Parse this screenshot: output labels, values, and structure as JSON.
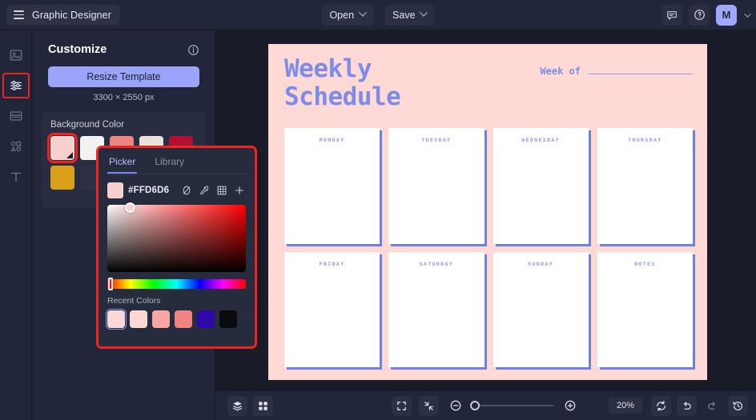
{
  "app": {
    "name": "Graphic Designer",
    "menu_icon": "hamburger-icon"
  },
  "topbar": {
    "open_label": "Open",
    "save_label": "Save",
    "comment_icon": "comment-icon",
    "help_icon": "help-icon",
    "avatar_initial": "M",
    "avatar_color": "#a1a8fb"
  },
  "rail": {
    "items": [
      {
        "name": "image-icon",
        "selected": false
      },
      {
        "name": "adjustments-icon",
        "selected": true
      },
      {
        "name": "layout-icon",
        "selected": false
      },
      {
        "name": "shapes-icon",
        "selected": false
      },
      {
        "name": "text-icon",
        "selected": false
      }
    ]
  },
  "panel": {
    "title": "Customize",
    "info_icon": "info-icon",
    "resize_label": "Resize Template",
    "dimensions": "3300 × 2550 px",
    "background": {
      "label": "Background Color",
      "swatches": [
        {
          "color": "#f8cfcf",
          "selected": true
        },
        {
          "color": "#f2f2f0",
          "selected": false
        },
        {
          "color": "#b11030",
          "selected": false
        },
        {
          "color": "#d9a017",
          "selected": false
        }
      ]
    }
  },
  "picker": {
    "tabs": [
      {
        "label": "Picker",
        "active": true
      },
      {
        "label": "Library",
        "active": false
      }
    ],
    "hex": "#FFD6D6",
    "swatch_color": "#f8cfcf",
    "tools": [
      {
        "name": "no-color-icon"
      },
      {
        "name": "eyedropper-icon"
      },
      {
        "name": "palette-grid-icon"
      },
      {
        "name": "add-color-icon"
      }
    ],
    "recent_label": "Recent Colors",
    "recent_colors": [
      {
        "color": "#fbd7d6",
        "selected": true
      },
      {
        "color": "#fdd8d2",
        "selected": false
      },
      {
        "color": "#f9a5a3",
        "selected": false
      },
      {
        "color": "#ef8582",
        "selected": false
      },
      {
        "color": "#2f08a8",
        "selected": false
      },
      {
        "color": "#0b0b0d",
        "selected": false
      }
    ]
  },
  "canvas": {
    "background_color": "#ffd9d6",
    "accent_color": "#7d8ce8",
    "title_line1": "Weekly",
    "title_line2": "Schedule",
    "week_of_label": "Week of",
    "cards": [
      {
        "label": "MONDAY"
      },
      {
        "label": "TUESDAY"
      },
      {
        "label": "WEDNESDAY"
      },
      {
        "label": "THURSDAY"
      },
      {
        "label": "FRIDAY"
      },
      {
        "label": "SATURDAY"
      },
      {
        "label": "SUNDAY"
      },
      {
        "label": "NOTES"
      }
    ]
  },
  "bottombar": {
    "layers_icon": "layers-icon",
    "grid_icon": "grid-icon",
    "fit_icon": "fit-screen-icon",
    "shrink_icon": "shrink-icon",
    "zoom_out_icon": "zoom-out-icon",
    "zoom_in_icon": "zoom-in-icon",
    "zoom_value": "20%",
    "reset_icon": "reset-icon",
    "undo_icon": "undo-icon",
    "redo_icon": "redo-icon",
    "history_icon": "history-icon"
  }
}
